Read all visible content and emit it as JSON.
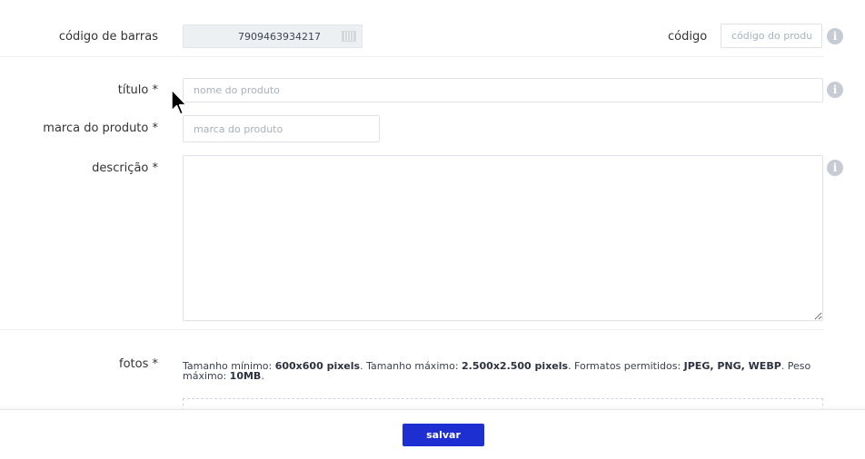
{
  "form": {
    "barcode": {
      "label": "código de barras",
      "value": "7909463934217"
    },
    "code": {
      "label": "código",
      "placeholder": "código do produto"
    },
    "title": {
      "label": "título *",
      "placeholder": "nome do produto"
    },
    "brand": {
      "label": "marca do produto *",
      "placeholder": "marca do produto"
    },
    "description": {
      "label": "descrição *",
      "value": ""
    },
    "photos": {
      "label": "fotos *",
      "help": {
        "t1": "Tamanho mínimo: ",
        "b1": "600x600 pixels",
        "t2": ". Tamanho máximo: ",
        "b2": "2.500x2.500 pixels",
        "t3": ". Formatos permitidos: ",
        "b3": "JPEG, PNG, WEBP",
        "t4": ". Peso máximo: ",
        "b4": "10MB",
        "t5": "."
      }
    },
    "info_glyph": "i"
  },
  "footer": {
    "save_label": "salvar"
  },
  "colors": {
    "primary_button": "#1d2fd1",
    "info_icon": "#c7cbd3",
    "barcode_background": "#edf0f2"
  },
  "icons": [
    "info-icon",
    "barcode-icon",
    "mouse-pointer-icon"
  ]
}
